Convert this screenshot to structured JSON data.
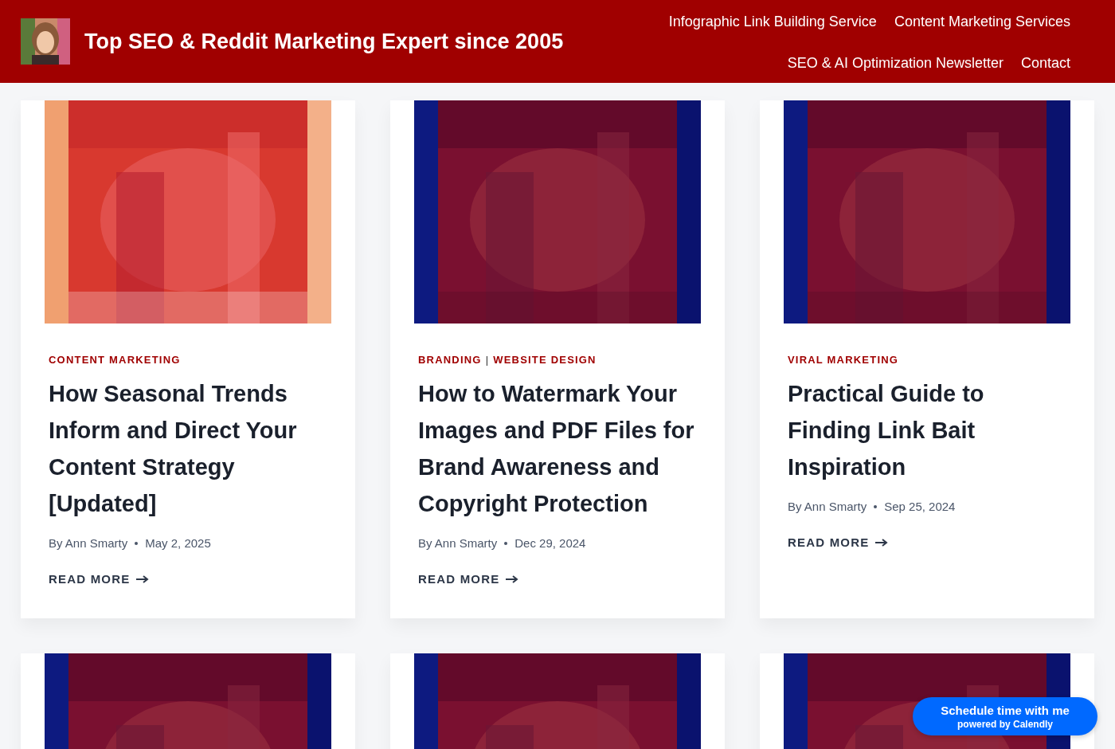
{
  "header": {
    "site_title": "Top SEO & Reddit Marketing Expert since 2005",
    "nav": [
      {
        "label": "Infographic Link Building Service"
      },
      {
        "label": "Content Marketing Services"
      },
      {
        "label": "SEO & AI Optimization Newsletter"
      },
      {
        "label": "Contact"
      }
    ]
  },
  "posts": [
    {
      "kind": "full",
      "categories": [
        "CONTENT MARKETING"
      ],
      "title": "How Seasonal Trends Inform and Direct Your Content Strategy [Updated]",
      "author": "By Ann Smarty",
      "date": "May 2, 2025",
      "read_more": "READ MORE"
    },
    {
      "kind": "full",
      "categories": [
        "BRANDING",
        "WEBSITE DESIGN"
      ],
      "separator": "|",
      "title": "How to Watermark Your Images and PDF Files for Brand Awareness and Copyright Protection",
      "author": "By Ann Smarty",
      "date": "Dec 29, 2024",
      "read_more": "READ MORE"
    },
    {
      "kind": "full",
      "categories": [
        "VIRAL MARKETING"
      ],
      "title": "Practical Guide to Finding Link Bait Inspiration",
      "author": "By Ann Smarty",
      "date": "Sep 25, 2024",
      "read_more": "READ MORE"
    },
    {
      "kind": "image_only"
    },
    {
      "kind": "image_only"
    },
    {
      "kind": "image_only"
    }
  ],
  "scheduler": {
    "label": "Schedule time with me",
    "sublabel": "powered by Calendly"
  }
}
